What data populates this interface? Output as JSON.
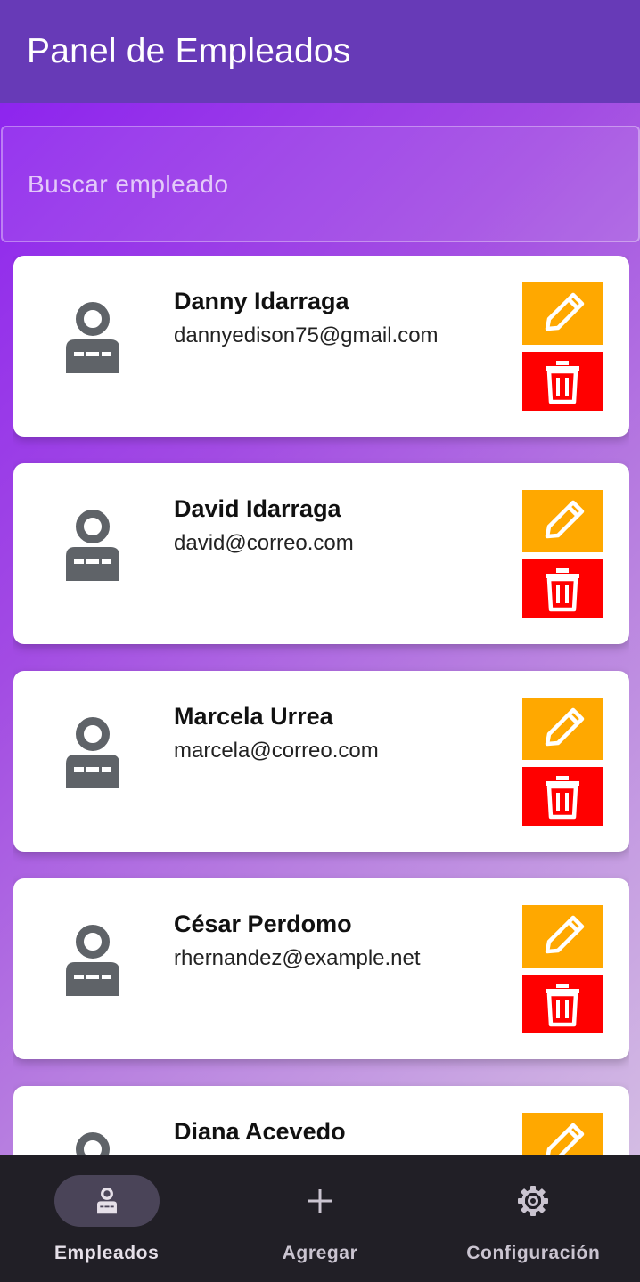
{
  "appbar": {
    "title": "Panel de Empleados",
    "color": "#673ab7"
  },
  "search": {
    "placeholder": "Buscar empleado",
    "value": ""
  },
  "employees": [
    {
      "name": "Danny Idarraga",
      "email": "dannyedison75@gmail.com"
    },
    {
      "name": "David Idarraga",
      "email": "david@correo.com"
    },
    {
      "name": "Marcela Urrea",
      "email": "marcela@correo.com"
    },
    {
      "name": "César Perdomo",
      "email": "rhernandez@example.net"
    },
    {
      "name": "Diana Acevedo",
      "email": ""
    }
  ],
  "icons": {
    "avatar": "person-icon",
    "edit": "pencil-icon",
    "delete": "trash-icon"
  },
  "colors": {
    "edit": "#ffa800",
    "delete": "#ff0000",
    "nav_bg": "#211f26"
  },
  "bottom_nav": [
    {
      "label": "Empleados",
      "icon": "people-icon",
      "active": true
    },
    {
      "label": "Agregar",
      "icon": "plus-icon",
      "active": false
    },
    {
      "label": "Configuración",
      "icon": "gear-icon",
      "active": false
    }
  ]
}
